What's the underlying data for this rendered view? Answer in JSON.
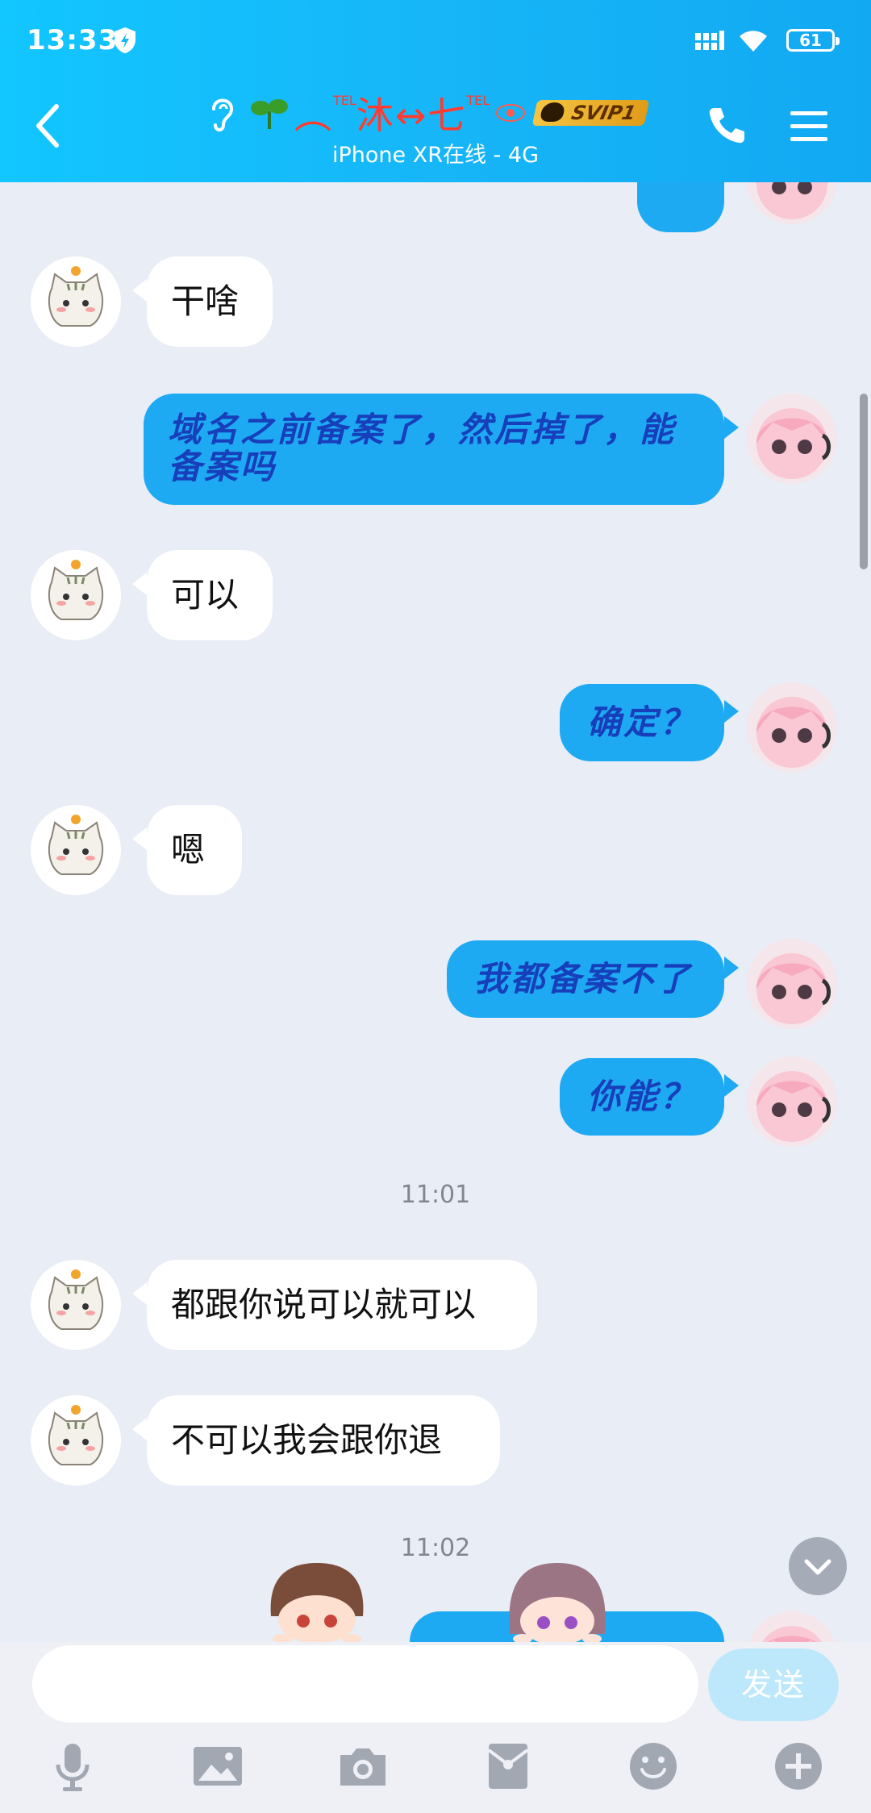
{
  "status_bar": {
    "time": "13:33",
    "battery": "61"
  },
  "header": {
    "nickname_left": "︵",
    "tel_left": "TEL",
    "nickname_mid": "沐↔七",
    "tel_right": "TEL",
    "vip_badge": "SVIP1",
    "subtitle": "iPhone XR在线 - 4G"
  },
  "messages": [
    {
      "text": "干啥"
    },
    {
      "text_line1": "域名之前备案了，然后掉了，能",
      "text_line2": "备案吗"
    },
    {
      "text": "可以"
    },
    {
      "text": "确定？"
    },
    {
      "text": "嗯"
    },
    {
      "text": "我都备案不了"
    },
    {
      "text": "你能？"
    },
    {
      "text": "都跟你说可以就可以"
    },
    {
      "text": "不可以我会跟你退"
    }
  ],
  "timestamps": [
    "11:01",
    "11:02"
  ],
  "input": {
    "placeholder": "",
    "send_label": "发送"
  },
  "toolbar": [
    "microphone-icon",
    "image-icon",
    "camera-icon",
    "red-packet-icon",
    "emoji-icon",
    "plus-icon"
  ],
  "colors": {
    "header": "#16b6f8",
    "out_bubble": "#1eaaf3",
    "out_text": "#173fbb",
    "nickname": "#ff3b2f"
  }
}
